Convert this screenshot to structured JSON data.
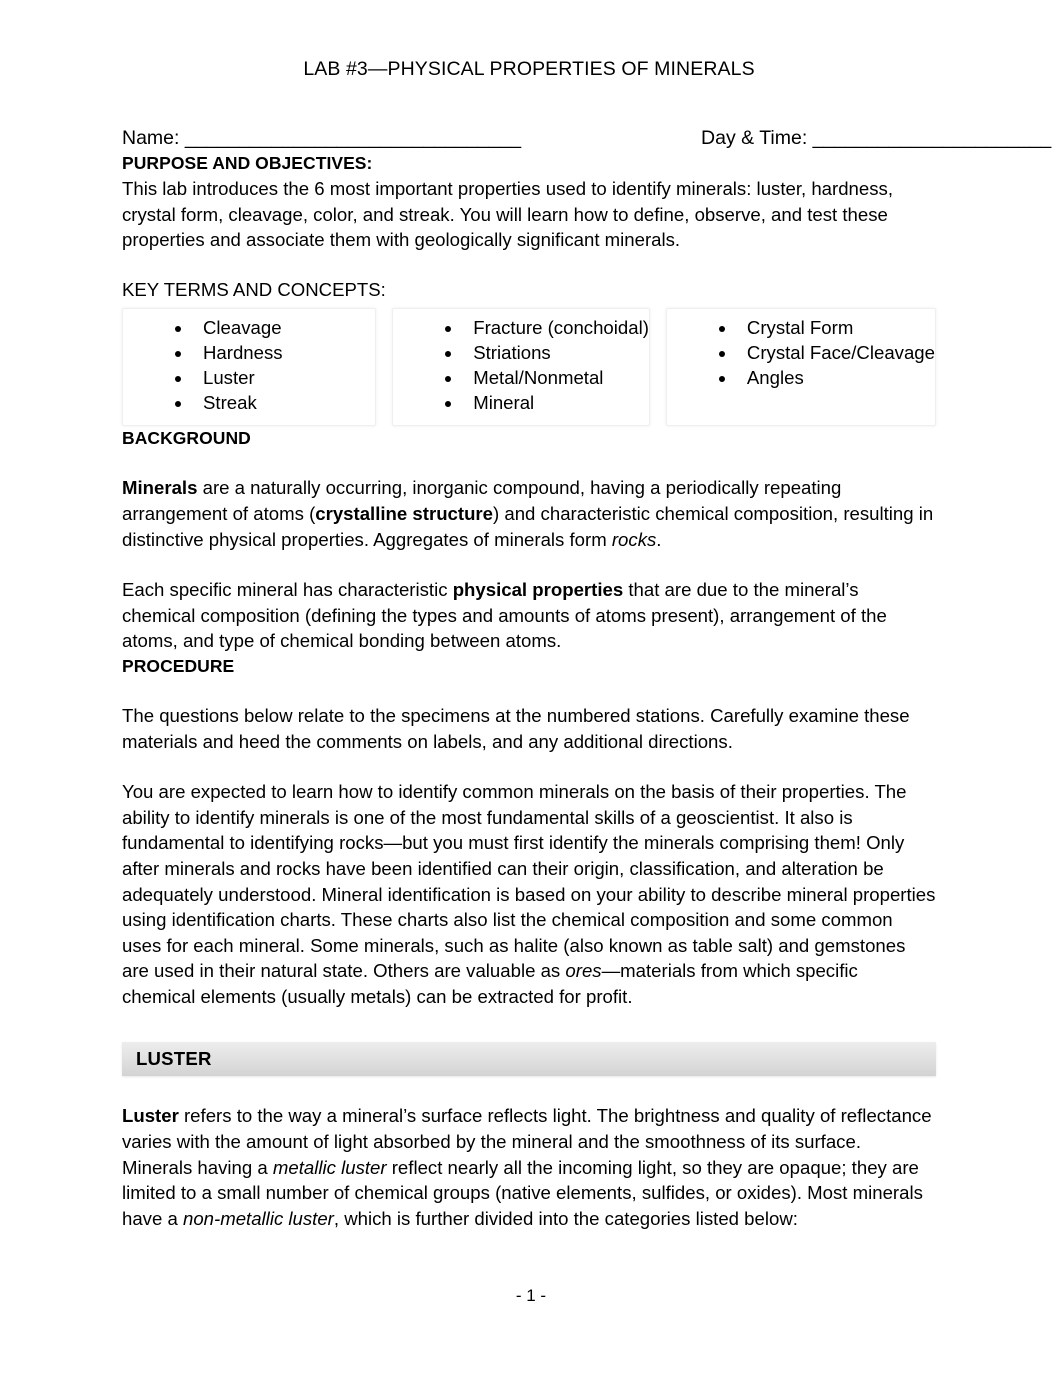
{
  "document": {
    "title": "LAB #3—PHYSICAL PROPERTIES OF MINERALS",
    "page_footer": "- 1 -"
  },
  "header_fields": {
    "name_label": "Name: _______________________________",
    "daytime_label": "Day & Time: ______________________"
  },
  "purpose": {
    "heading": "PURPOSE AND OBJECTIVES:",
    "body": "This lab introduces the 6 most important properties used to identify minerals: luster, hardness, crystal form, cleavage, color, and streak. You will learn how to define, observe, and test these properties and associate them with geologically significant minerals."
  },
  "key_terms": {
    "heading": "KEY TERMS AND CONCEPTS:",
    "columns": [
      {
        "items": [
          "Cleavage",
          "Hardness",
          "Luster",
          "Streak"
        ]
      },
      {
        "items": [
          "Fracture (conchoidal)",
          "Striations",
          "Metal/Nonmetal",
          "Mineral"
        ]
      },
      {
        "items": [
          "Crystal Form",
          "Crystal Face/Cleavage",
          "Angles"
        ]
      }
    ]
  },
  "background": {
    "heading": "BACKGROUND",
    "paragraph1": {
      "run1_bold": "Minerals",
      "run2": " are a naturally occurring, inorganic compound, having a periodically repeating arrangement of atoms (",
      "run3_bold": "crystalline structure",
      "run4": ") and characteristic chemical composition, resulting in distinctive physical properties. Aggregates of minerals form ",
      "run5_italic": "rocks",
      "run6": "."
    },
    "paragraph2": {
      "run1": "Each specific mineral has characteristic ",
      "run2_bold": "physical properties",
      "run3": " that are due to the mineral’s chemical composition (defining the types and amounts of atoms present), arrangement of the atoms, and type of chemical bonding between atoms."
    }
  },
  "procedure": {
    "heading": "PROCEDURE",
    "paragraph1": "The questions below relate to the specimens at the numbered stations. Carefully examine these materials and heed the comments on labels, and any additional directions.",
    "paragraph2": {
      "run1": "You are expected to learn how to identify common minerals on the basis of their properties. The ability to identify minerals is one of the most fundamental skills of a geoscientist. It also is fundamental to identifying rocks—but you must first identify the minerals comprising them! Only after minerals and rocks have been identified can their origin, classification, and alteration be adequately understood. Mineral identification is based on your ability to describe mineral properties using identification charts. These charts also list the chemical composition and some common uses for each mineral. Some minerals, such as halite (also known as table salt) and gemstones are used in their natural state. Others are valuable as ",
      "run2_italic": "ores",
      "run3": "—materials from which specific chemical elements (usually metals) can be extracted for profit."
    }
  },
  "luster": {
    "band_title": "LUSTER",
    "paragraph": {
      "run1_bold": "Luster",
      "run2": " refers to the way a mineral’s surface reflects light. The brightness and quality of reflectance varies with the amount of light absorbed by the mineral and the smoothness of its surface. Minerals having a ",
      "run3_italic": "metallic luster",
      "run4": " reflect nearly all the incoming light, so they are opaque; they are limited to a small number of chemical groups (native elements, sulfides, or oxides). Most minerals have a ",
      "run5_italic": "non-metallic luster",
      "run6": ", which is further divided into the categories listed below:"
    }
  },
  "colors": {
    "text": "#000000",
    "band_fill": "#e2e2e2",
    "cell_border": "#efefef",
    "page_background": "#ffffff"
  }
}
